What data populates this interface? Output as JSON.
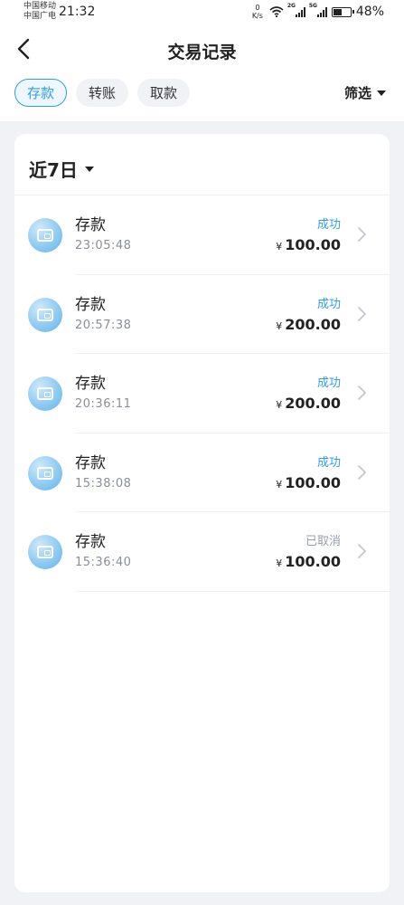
{
  "status_bar": {
    "carrier1": "中国移动",
    "carrier2": "中国广电",
    "time": "21:32",
    "net_speed_value": "0",
    "net_speed_unit": "K/s",
    "sig1_tag": "2G",
    "sig2_tag": "5G",
    "battery_percent": "48%",
    "battery_level": 0.48
  },
  "header": {
    "title": "交易记录",
    "back_icon": "chevron-left-icon"
  },
  "tabs": [
    {
      "label": "存款",
      "active": true
    },
    {
      "label": "转账",
      "active": false
    },
    {
      "label": "取款",
      "active": false
    }
  ],
  "filter": {
    "label": "筛选"
  },
  "period": {
    "label": "近7日"
  },
  "records": [
    {
      "title": "存款",
      "time": "23:05:48",
      "status": "成功",
      "currency": "¥",
      "amount": "100.00"
    },
    {
      "title": "存款",
      "time": "20:57:38",
      "status": "成功",
      "currency": "¥",
      "amount": "200.00"
    },
    {
      "title": "存款",
      "time": "20:36:11",
      "status": "成功",
      "currency": "¥",
      "amount": "200.00"
    },
    {
      "title": "存款",
      "time": "15:38:08",
      "status": "成功",
      "currency": "¥",
      "amount": "100.00"
    },
    {
      "title": "存款",
      "time": "15:36:40",
      "status": "已取消",
      "currency": "¥",
      "amount": "100.00"
    }
  ],
  "colors": {
    "accent": "#2d9ee8",
    "cancelled": "#9a9ea8",
    "page_bg": "#f1f2f5"
  }
}
